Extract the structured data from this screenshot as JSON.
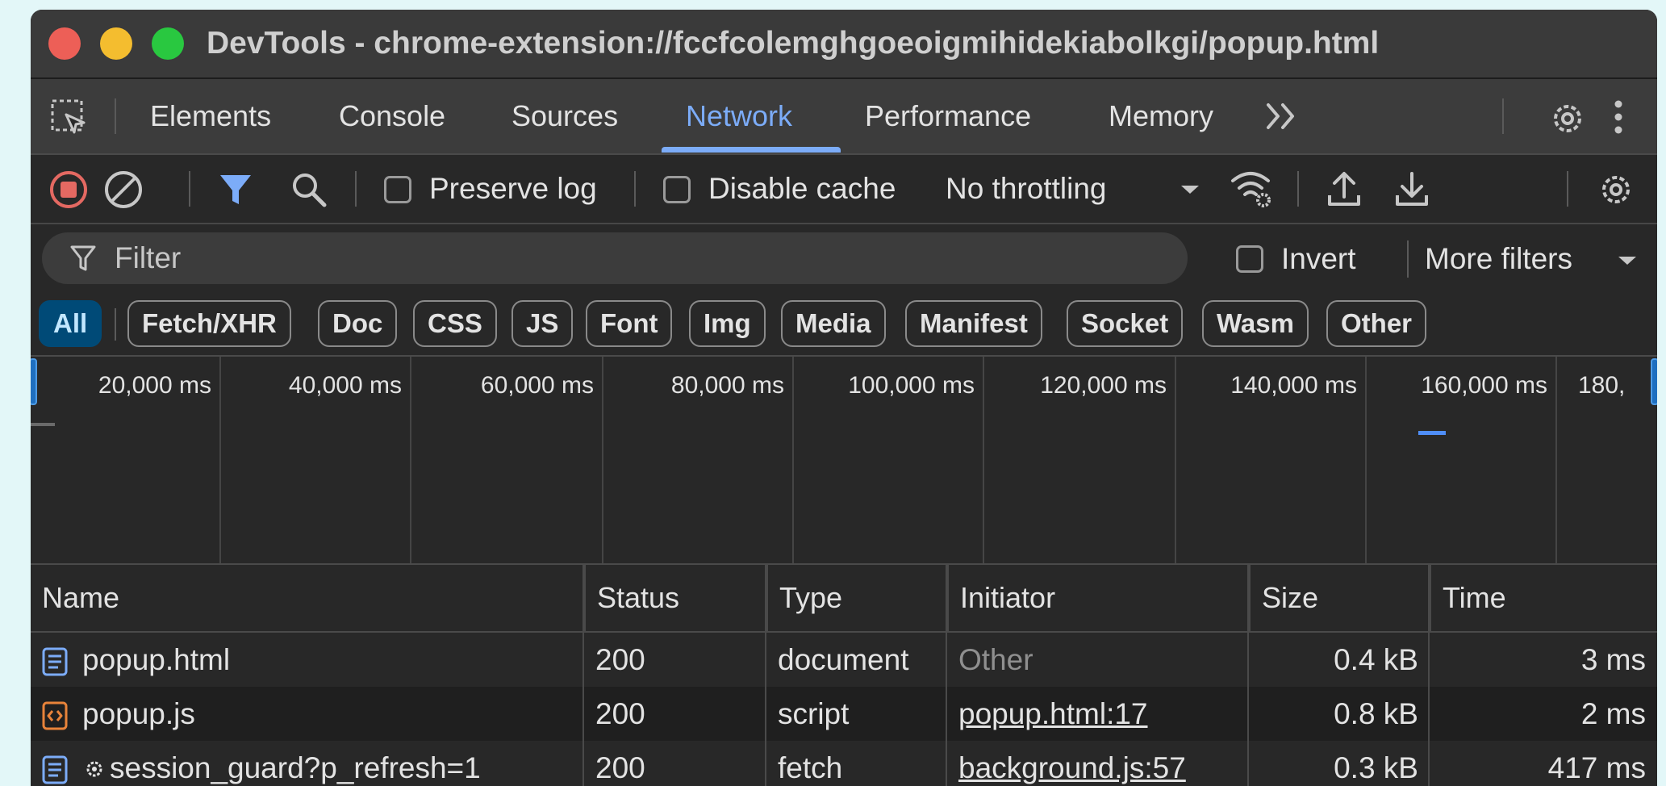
{
  "window": {
    "title": "DevTools - chrome-extension://fccfcolemghgoeoigmihidekiabolkgi/popup.html"
  },
  "tabs": [
    {
      "label": "Elements"
    },
    {
      "label": "Console"
    },
    {
      "label": "Sources"
    },
    {
      "label": "Network",
      "active": true
    },
    {
      "label": "Performance"
    },
    {
      "label": "Memory"
    }
  ],
  "toolbar": {
    "preserve_log_label": "Preserve log",
    "preserve_log_checked": false,
    "disable_cache_label": "Disable cache",
    "disable_cache_checked": false,
    "throttling_value": "No throttling"
  },
  "filter": {
    "placeholder": "Filter",
    "invert_label": "Invert",
    "invert_checked": false,
    "more_filters_label": "More filters"
  },
  "type_filters": [
    {
      "label": "All",
      "active": true
    },
    {
      "label": "Fetch/XHR"
    },
    {
      "label": "Doc"
    },
    {
      "label": "CSS"
    },
    {
      "label": "JS"
    },
    {
      "label": "Font"
    },
    {
      "label": "Img"
    },
    {
      "label": "Media"
    },
    {
      "label": "Manifest"
    },
    {
      "label": "Socket"
    },
    {
      "label": "Wasm"
    },
    {
      "label": "Other"
    }
  ],
  "overview": {
    "ticks": [
      "20,000 ms",
      "40,000 ms",
      "60,000 ms",
      "80,000 ms",
      "100,000 ms",
      "120,000 ms",
      "140,000 ms",
      "160,000 ms",
      "180,"
    ]
  },
  "table": {
    "columns": [
      "Name",
      "Status",
      "Type",
      "Initiator",
      "Size",
      "Time"
    ],
    "rows": [
      {
        "icon": "document-icon",
        "name": "popup.html",
        "status": "200",
        "type": "document",
        "initiator": "Other",
        "size": "0.4 kB",
        "time": "3 ms"
      },
      {
        "icon": "script-icon",
        "name": "popup.js",
        "status": "200",
        "type": "script",
        "initiator": "popup.html:17",
        "size": "0.8 kB",
        "time": "2 ms"
      },
      {
        "icon": "document-icon",
        "name": "session_guard?p_refresh=1",
        "status": "200",
        "type": "fetch",
        "initiator": "background.js:57",
        "size": "0.3 kB",
        "time": "417 ms"
      }
    ]
  },
  "colors": {
    "accent": "#7cacf8",
    "record_stop": "#e46962",
    "active_chip_bg": "#004a77"
  }
}
